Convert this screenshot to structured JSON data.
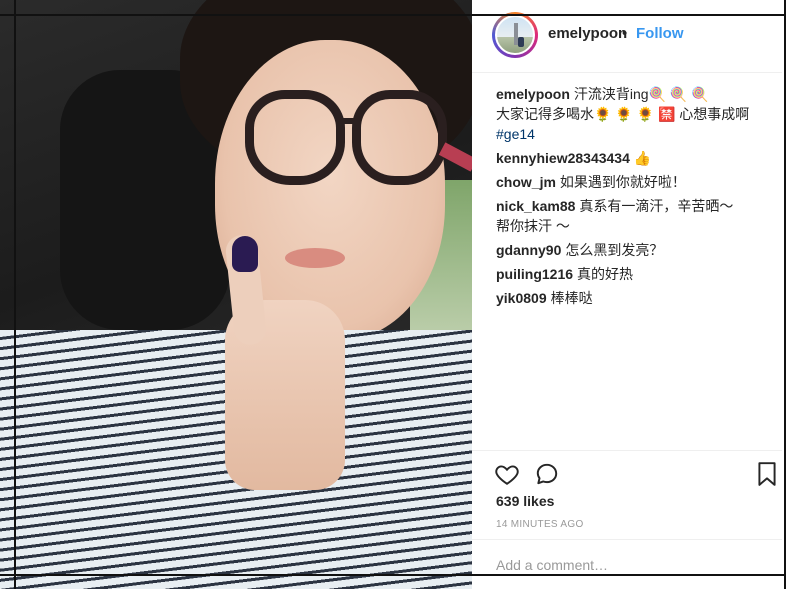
{
  "post": {
    "username": "emelypoon",
    "separator": "•",
    "follow_label": "Follow",
    "comments": [
      {
        "user": "emelypoon",
        "text": "汗流浃背ing🍭 🍭 🍭\n大家记得多喝水🌻 🌻 🌻 🈲 心想事成啊",
        "hashtag": "#ge14"
      },
      {
        "user": "kennyhiew28343434",
        "text": "👍"
      },
      {
        "user": "chow_jm",
        "text": "如果遇到你就好啦！"
      },
      {
        "user": "nick_kam88",
        "text": "真系有一滴汗，辛苦晒～\n帮你抹汗 ～"
      },
      {
        "user": "gdanny90",
        "text": "怎么黑到发亮？"
      },
      {
        "user": "puiling1216",
        "text": "真的好热"
      },
      {
        "user": "yik0809",
        "text": "棒棒哒"
      }
    ],
    "likes": "639 likes",
    "time": "14 MINUTES AGO",
    "add_comment_placeholder": "Add a comment…"
  },
  "icons": {
    "like": "heart-icon",
    "comment": "speech-bubble-icon",
    "save": "bookmark-icon"
  },
  "colors": {
    "follow": "#3897f0",
    "hashtag": "#003569",
    "meta": "#999999"
  }
}
